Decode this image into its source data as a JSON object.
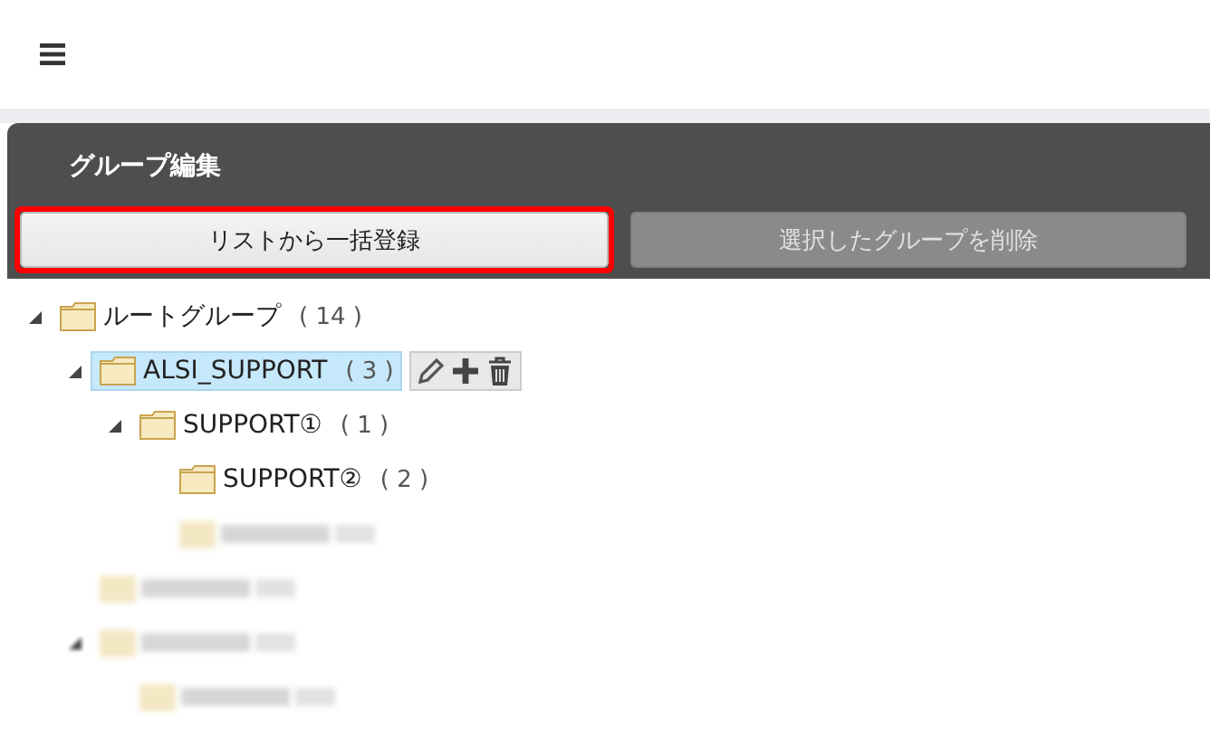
{
  "panel": {
    "title": "グループ編集"
  },
  "buttons": [
    {
      "label": "リストから一括登録",
      "disabled": false,
      "highlighted": true
    },
    {
      "label": "選択したグループを削除",
      "disabled": true,
      "highlighted": false
    }
  ],
  "tree": [
    {
      "kind": "group",
      "label": "ルートグループ",
      "count": "( 14 )",
      "expanded": true,
      "selected": false,
      "children": [
        {
          "kind": "group",
          "label": "ALSI_SUPPORT",
          "count": "( 3 )",
          "expanded": true,
          "selected": true,
          "children": [
            {
              "kind": "group",
              "label": "SUPPORT①",
              "count": "( 1 )",
              "expanded": true,
              "selected": false,
              "children": [
                {
                  "kind": "group",
                  "label": "SUPPORT②",
                  "count": "( 2 )",
                  "selected": false
                },
                {
                  "kind": "redacted"
                }
              ]
            }
          ]
        },
        {
          "kind": "redacted"
        },
        {
          "kind": "redacted",
          "expanded": true,
          "children": [
            {
              "kind": "redacted"
            }
          ]
        }
      ]
    }
  ]
}
